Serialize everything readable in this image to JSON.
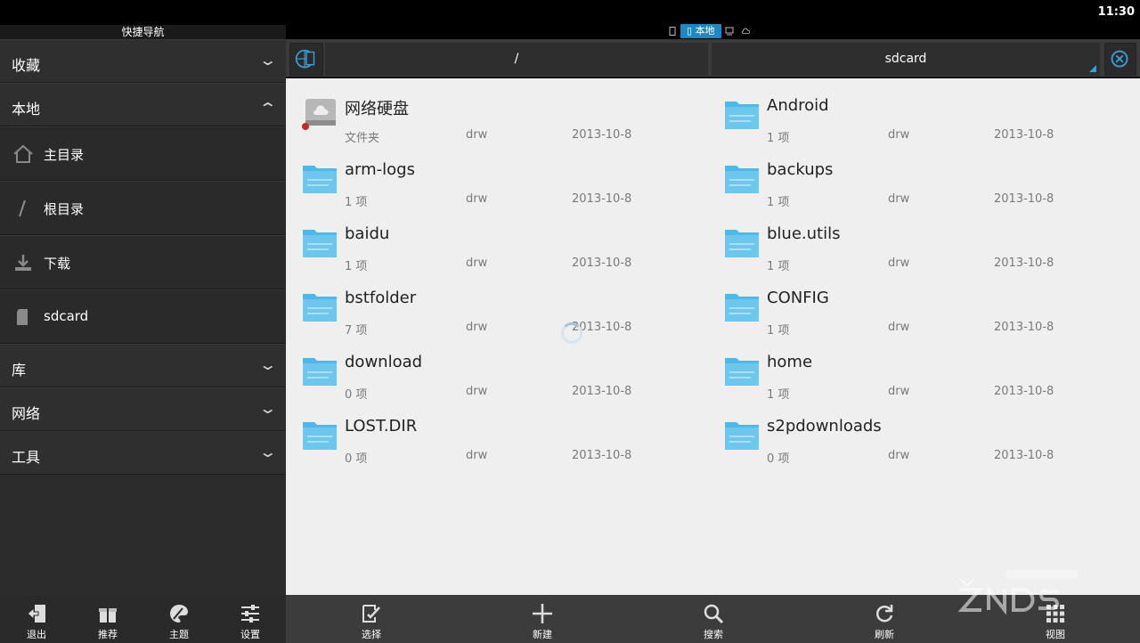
{
  "status_bar": {
    "time": "11:30"
  },
  "sidebar": {
    "title": "快捷导航",
    "sections": {
      "favorites": "收藏",
      "local": "本地",
      "library": "库",
      "network": "网络",
      "tools": "工具"
    },
    "items": [
      {
        "label": "主目录",
        "icon": "home-icon"
      },
      {
        "label": "根目录",
        "icon": "slash-icon"
      },
      {
        "label": "下载",
        "icon": "download-icon"
      },
      {
        "label": "sdcard",
        "icon": "sdcard-icon"
      }
    ]
  },
  "tabs": {
    "local": "本地"
  },
  "path": {
    "root": "/",
    "current": "sdcard"
  },
  "files": [
    {
      "name": "网络硬盘",
      "sub": "文件夹",
      "perm": "drw",
      "date": "2013-10-8",
      "icon": "cloud-drive-icon"
    },
    {
      "name": "Android",
      "sub": "1 项",
      "perm": "drw",
      "date": "2013-10-8",
      "icon": "folder-icon"
    },
    {
      "name": "arm-logs",
      "sub": "1 项",
      "perm": "drw",
      "date": "2013-10-8",
      "icon": "folder-icon"
    },
    {
      "name": "backups",
      "sub": "1 项",
      "perm": "drw",
      "date": "2013-10-8",
      "icon": "folder-icon"
    },
    {
      "name": "baidu",
      "sub": "1 项",
      "perm": "drw",
      "date": "2013-10-8",
      "icon": "folder-icon"
    },
    {
      "name": "blue.utils",
      "sub": "1 项",
      "perm": "drw",
      "date": "2013-10-8",
      "icon": "folder-icon"
    },
    {
      "name": "bstfolder",
      "sub": "7 项",
      "perm": "drw",
      "date": "2013-10-8",
      "icon": "folder-icon"
    },
    {
      "name": "CONFIG",
      "sub": "1 项",
      "perm": "drw",
      "date": "2013-10-8",
      "icon": "folder-icon"
    },
    {
      "name": "download",
      "sub": "0 项",
      "perm": "drw",
      "date": "2013-10-8",
      "icon": "folder-icon"
    },
    {
      "name": "home",
      "sub": "1 项",
      "perm": "drw",
      "date": "2013-10-8",
      "icon": "folder-icon"
    },
    {
      "name": "LOST.DIR",
      "sub": "0 项",
      "perm": "drw",
      "date": "2013-10-8",
      "icon": "folder-icon"
    },
    {
      "name": "s2pdownloads",
      "sub": "0 项",
      "perm": "drw",
      "date": "2013-10-8",
      "icon": "folder-icon"
    }
  ],
  "left_toolbar": [
    {
      "label": "退出",
      "icon": "exit-icon"
    },
    {
      "label": "推荐",
      "icon": "gift-icon"
    },
    {
      "label": "主题",
      "icon": "palette-icon"
    },
    {
      "label": "设置",
      "icon": "sliders-icon"
    }
  ],
  "main_toolbar": [
    {
      "label": "选择",
      "icon": "select-icon"
    },
    {
      "label": "新建",
      "icon": "plus-icon"
    },
    {
      "label": "搜索",
      "icon": "search-icon"
    },
    {
      "label": "刷新",
      "icon": "refresh-icon"
    },
    {
      "label": "视图",
      "icon": "grid-icon"
    }
  ],
  "colors": {
    "accent": "#1e88c0",
    "folder": "#4fb8e6",
    "content_bg": "#efefef",
    "sidebar_bg": "#2c2c2c"
  }
}
